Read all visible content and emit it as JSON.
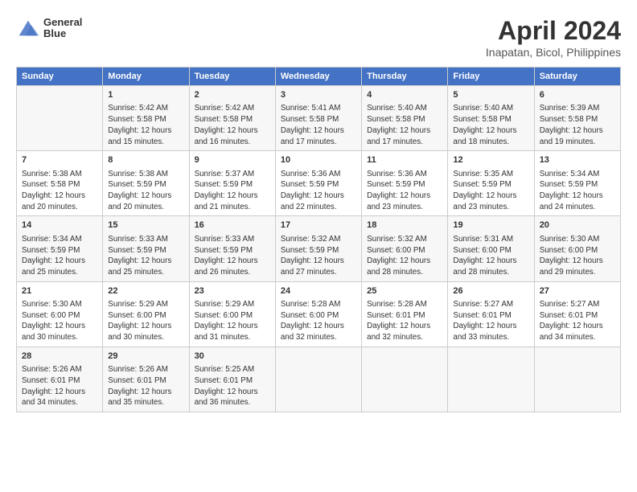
{
  "logo": {
    "line1": "General",
    "line2": "Blue"
  },
  "title": "April 2024",
  "subtitle": "Inapatan, Bicol, Philippines",
  "days_header": [
    "Sunday",
    "Monday",
    "Tuesday",
    "Wednesday",
    "Thursday",
    "Friday",
    "Saturday"
  ],
  "weeks": [
    [
      {
        "day": "",
        "info": ""
      },
      {
        "day": "1",
        "info": "Sunrise: 5:42 AM\nSunset: 5:58 PM\nDaylight: 12 hours\nand 15 minutes."
      },
      {
        "day": "2",
        "info": "Sunrise: 5:42 AM\nSunset: 5:58 PM\nDaylight: 12 hours\nand 16 minutes."
      },
      {
        "day": "3",
        "info": "Sunrise: 5:41 AM\nSunset: 5:58 PM\nDaylight: 12 hours\nand 17 minutes."
      },
      {
        "day": "4",
        "info": "Sunrise: 5:40 AM\nSunset: 5:58 PM\nDaylight: 12 hours\nand 17 minutes."
      },
      {
        "day": "5",
        "info": "Sunrise: 5:40 AM\nSunset: 5:58 PM\nDaylight: 12 hours\nand 18 minutes."
      },
      {
        "day": "6",
        "info": "Sunrise: 5:39 AM\nSunset: 5:58 PM\nDaylight: 12 hours\nand 19 minutes."
      }
    ],
    [
      {
        "day": "7",
        "info": "Sunrise: 5:38 AM\nSunset: 5:58 PM\nDaylight: 12 hours\nand 20 minutes."
      },
      {
        "day": "8",
        "info": "Sunrise: 5:38 AM\nSunset: 5:59 PM\nDaylight: 12 hours\nand 20 minutes."
      },
      {
        "day": "9",
        "info": "Sunrise: 5:37 AM\nSunset: 5:59 PM\nDaylight: 12 hours\nand 21 minutes."
      },
      {
        "day": "10",
        "info": "Sunrise: 5:36 AM\nSunset: 5:59 PM\nDaylight: 12 hours\nand 22 minutes."
      },
      {
        "day": "11",
        "info": "Sunrise: 5:36 AM\nSunset: 5:59 PM\nDaylight: 12 hours\nand 23 minutes."
      },
      {
        "day": "12",
        "info": "Sunrise: 5:35 AM\nSunset: 5:59 PM\nDaylight: 12 hours\nand 23 minutes."
      },
      {
        "day": "13",
        "info": "Sunrise: 5:34 AM\nSunset: 5:59 PM\nDaylight: 12 hours\nand 24 minutes."
      }
    ],
    [
      {
        "day": "14",
        "info": "Sunrise: 5:34 AM\nSunset: 5:59 PM\nDaylight: 12 hours\nand 25 minutes."
      },
      {
        "day": "15",
        "info": "Sunrise: 5:33 AM\nSunset: 5:59 PM\nDaylight: 12 hours\nand 25 minutes."
      },
      {
        "day": "16",
        "info": "Sunrise: 5:33 AM\nSunset: 5:59 PM\nDaylight: 12 hours\nand 26 minutes."
      },
      {
        "day": "17",
        "info": "Sunrise: 5:32 AM\nSunset: 5:59 PM\nDaylight: 12 hours\nand 27 minutes."
      },
      {
        "day": "18",
        "info": "Sunrise: 5:32 AM\nSunset: 6:00 PM\nDaylight: 12 hours\nand 28 minutes."
      },
      {
        "day": "19",
        "info": "Sunrise: 5:31 AM\nSunset: 6:00 PM\nDaylight: 12 hours\nand 28 minutes."
      },
      {
        "day": "20",
        "info": "Sunrise: 5:30 AM\nSunset: 6:00 PM\nDaylight: 12 hours\nand 29 minutes."
      }
    ],
    [
      {
        "day": "21",
        "info": "Sunrise: 5:30 AM\nSunset: 6:00 PM\nDaylight: 12 hours\nand 30 minutes."
      },
      {
        "day": "22",
        "info": "Sunrise: 5:29 AM\nSunset: 6:00 PM\nDaylight: 12 hours\nand 30 minutes."
      },
      {
        "day": "23",
        "info": "Sunrise: 5:29 AM\nSunset: 6:00 PM\nDaylight: 12 hours\nand 31 minutes."
      },
      {
        "day": "24",
        "info": "Sunrise: 5:28 AM\nSunset: 6:00 PM\nDaylight: 12 hours\nand 32 minutes."
      },
      {
        "day": "25",
        "info": "Sunrise: 5:28 AM\nSunset: 6:01 PM\nDaylight: 12 hours\nand 32 minutes."
      },
      {
        "day": "26",
        "info": "Sunrise: 5:27 AM\nSunset: 6:01 PM\nDaylight: 12 hours\nand 33 minutes."
      },
      {
        "day": "27",
        "info": "Sunrise: 5:27 AM\nSunset: 6:01 PM\nDaylight: 12 hours\nand 34 minutes."
      }
    ],
    [
      {
        "day": "28",
        "info": "Sunrise: 5:26 AM\nSunset: 6:01 PM\nDaylight: 12 hours\nand 34 minutes."
      },
      {
        "day": "29",
        "info": "Sunrise: 5:26 AM\nSunset: 6:01 PM\nDaylight: 12 hours\nand 35 minutes."
      },
      {
        "day": "30",
        "info": "Sunrise: 5:25 AM\nSunset: 6:01 PM\nDaylight: 12 hours\nand 36 minutes."
      },
      {
        "day": "",
        "info": ""
      },
      {
        "day": "",
        "info": ""
      },
      {
        "day": "",
        "info": ""
      },
      {
        "day": "",
        "info": ""
      }
    ]
  ]
}
